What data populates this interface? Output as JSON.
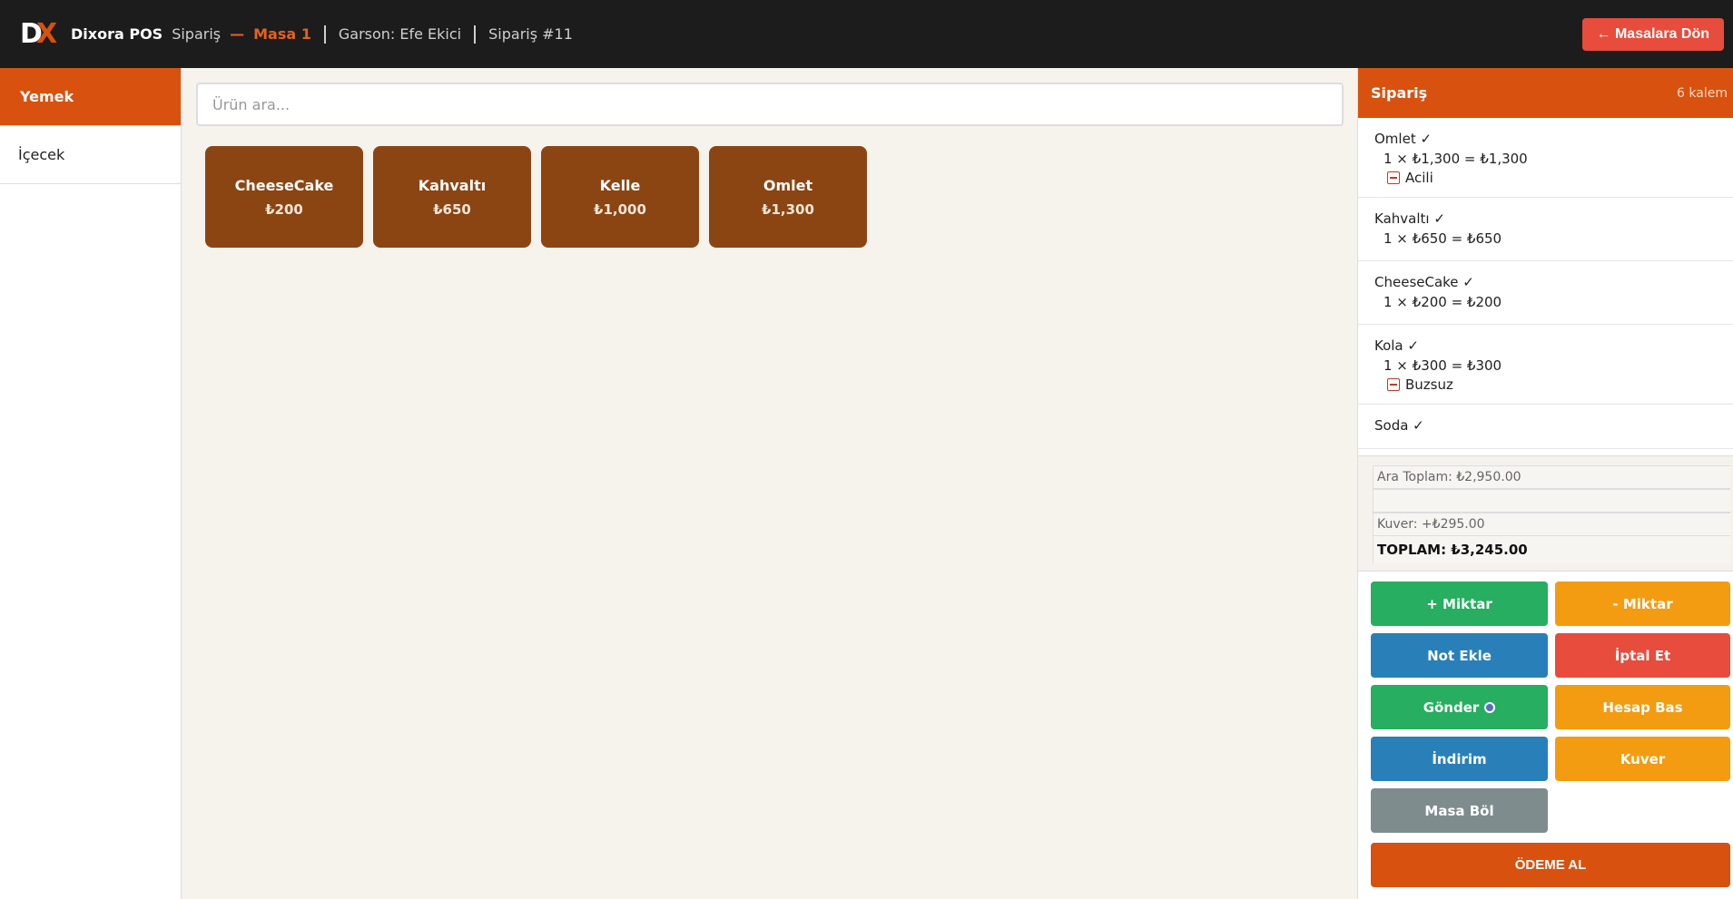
{
  "header": {
    "brand": "Dixora POS",
    "section": "Sipariş",
    "dash": "—",
    "table": "Masa 1",
    "waiter": "Garson: Efe Ekici",
    "order_no": "Sipariş #11",
    "back_label": "← Masalara Dön"
  },
  "sidebar": {
    "categories": [
      {
        "label": "Yemek",
        "active": true
      },
      {
        "label": "İçecek",
        "active": false
      }
    ]
  },
  "search": {
    "placeholder": "Ürün ara...",
    "value": ""
  },
  "products": [
    {
      "name": "CheeseCake",
      "price": "₺200"
    },
    {
      "name": "Kahvaltı",
      "price": "₺650"
    },
    {
      "name": "Kelle",
      "price": "₺1,000"
    },
    {
      "name": "Omlet",
      "price": "₺1,300"
    }
  ],
  "order": {
    "title": "Sipariş",
    "count": "6 kalem",
    "items": [
      {
        "name": "Omlet ✓",
        "line": "1 × ₺1,300 = ₺1,300",
        "note": "Acili"
      },
      {
        "name": "Kahvaltı ✓",
        "line": "1 × ₺650 = ₺650"
      },
      {
        "name": "CheeseCake ✓",
        "line": "1 × ₺200 = ₺200"
      },
      {
        "name": "Kola ✓",
        "line": "1 × ₺300 = ₺300",
        "note": "Buzsuz"
      },
      {
        "name": "Soda ✓"
      }
    ],
    "subtotal": "Ara Toplam: ₺2,950.00",
    "cover": "Kuver: +₺295.00",
    "total": "TOPLAM: ₺3,245.00"
  },
  "actions": {
    "plus_qty": "+ Miktar",
    "minus_qty": "- Miktar",
    "add_note": "Not Ekle",
    "cancel": "İptal Et",
    "send": "Gönder",
    "print_bill": "Hesap Bas",
    "discount": "İndirim",
    "cover": "Kuver",
    "split": "Masa Böl",
    "pay": "ÖDEME AL"
  },
  "colors": {
    "accent": "#d8510f",
    "product": "#8b4513",
    "green": "#27ae60",
    "orange": "#f39c12",
    "blue": "#2980b9",
    "red": "#e74c3c",
    "grey": "#7f8c8d"
  }
}
